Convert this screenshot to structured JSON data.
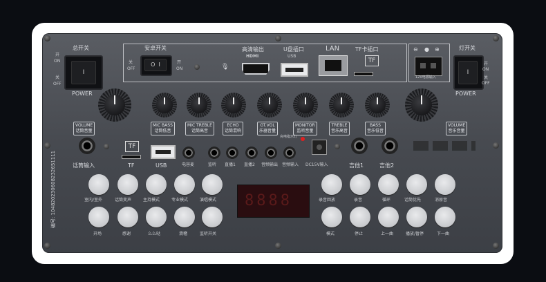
{
  "top_labels": {
    "power": "总开关",
    "android": "安卓开关",
    "hdmi": "高清输出",
    "hdmi_logo": "HDMI",
    "udisk": "U盘插口",
    "usb": "USB",
    "lan": "LAN",
    "tf": "TF卡插口",
    "light": "灯开关",
    "dc": "12V电源输入"
  },
  "left_switch": {
    "on_cn": "开",
    "on": "ON",
    "off_cn": "关",
    "off": "OFF",
    "label": "POWER"
  },
  "right_switch": {
    "on_cn": "开",
    "on": "ON",
    "off_cn": "关",
    "off": "OFF",
    "label": "POWER"
  },
  "android_switch": {
    "off_cn": "关",
    "off": "OFF",
    "on_cn": "开",
    "on": "ON"
  },
  "knobs": [
    {
      "en": "VOLUME",
      "cn": "话筒音量"
    },
    {
      "en": "MIC BASS",
      "cn": "话筒低音"
    },
    {
      "en": "MIC TREBLE",
      "cn": "话筒高音"
    },
    {
      "en": "ECHO",
      "cn": "话筒混响"
    },
    {
      "en": "GT.VOL",
      "cn": "乐器音量"
    },
    {
      "en": "MONITOR",
      "cn": "监听音量"
    },
    {
      "en": "TREBLE",
      "cn": "音乐高音"
    },
    {
      "en": "BASS",
      "cn": "音乐低音"
    },
    {
      "en": "VOLUME",
      "cn": "音乐音量"
    }
  ],
  "io_labels": [
    "话筒输入",
    "TF",
    "USB",
    "电容麦",
    "监听",
    "直播1",
    "直播2",
    "音频输出",
    "音频输入",
    "DC15V输入",
    "吉他1",
    "吉他2"
  ],
  "charge_label": "充电指示灯",
  "serial": "编号: 104820230608232651111",
  "left_buttons_row1": [
    "室内/室外",
    "话筒变声",
    "主持模式",
    "专业模式",
    "演唱模式"
  ],
  "left_buttons_row2": [
    "开场",
    "感谢",
    "么么哒",
    "滑稽",
    "监听开关"
  ],
  "right_buttons_row1": [
    "录音回放",
    "录音",
    "循环",
    "话筒优先",
    "消原音"
  ],
  "right_buttons_row2": [
    "模式",
    "停止",
    "上一曲",
    "播放/暂停",
    "下一曲"
  ],
  "display": "8888"
}
